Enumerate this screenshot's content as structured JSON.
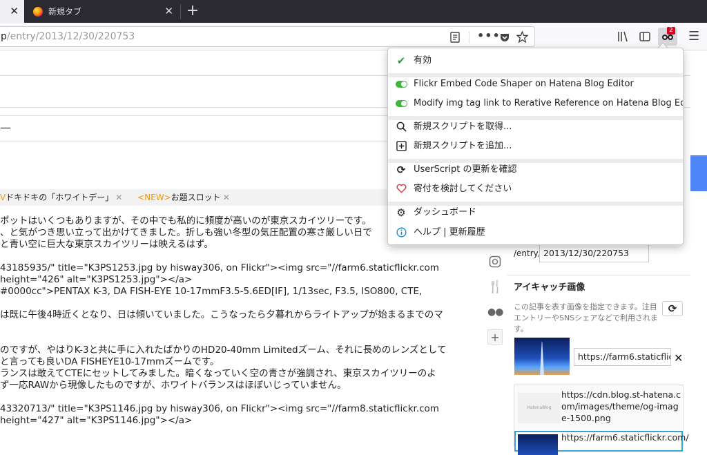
{
  "browser": {
    "tabs": [
      {
        "label": "",
        "active": true
      },
      {
        "label": "新規タブ",
        "active": false
      }
    ],
    "url_prefix": "p",
    "url_path": "/entry/2013/12/30/220753",
    "addon_badge": "2"
  },
  "menu": {
    "enabled_label": "有効",
    "scripts": [
      "Flickr Embed Code Shaper on Hatena Blog Editor",
      "Modify img tag link to Rerative Reference on Hatena Blog Editor"
    ],
    "get_new_scripts": "新規スクリプトを取得...",
    "add_new_script": "新規スクリプトを追加...",
    "check_updates": "UserScript の更新を確認",
    "donate": "寄付を検討してください",
    "dashboard": "ダッシュボード",
    "help": "ヘルプ | 更新履歴"
  },
  "editor": {
    "dash": "—",
    "tags": [
      {
        "new": "V",
        "text": "ドキドキの「ホワイトデー」"
      },
      {
        "new": "<NEW>",
        "text": "お題スロット"
      }
    ],
    "lines": [
      "ポットはいくつもありますが、その中でも私的に頻度が高いのが東京スカイツリーです。",
      "、と気がつき思い立って出かけてきました。折しも強い冬型の気圧配置の寒さ厳しい日で",
      "と青い空に巨大な東京スカイツリーは映えるはず。",
      "",
      "43185935/\" title=\"K3PS1253.jpg by hisway306, on Flickr\"><img src=\"//farm6.staticflickr.com",
      "height=\"426\" alt=\"K3PS1253.jpg\"></a>",
      " #0000cc\">PENTAX K-3, DA FISH-EYE 10-17mmF3.5-5.6ED[IF], 1/13sec, F3.5, ISO800, CTE,",
      "",
      "は既に午後4時近くとなり、日は傾いていました。こうなったら夕暮れからライトアップが始まるまでのマ",
      "",
      "",
      "のですが、やはりK-3と共に手に入れたばかりのHD20-40mm Limitedズーム、それに長めのレンズとして",
      "と言っても良いDA FISHEYE10-17mmズームです。",
      "ランスは敢えてCTEにセットしてみました。暗くなっていく空の青さが強調され、東京スカイツリーのよ",
      "ず一応RAWから現像したものですが、ホワイトバランスはほぼいじっていません。",
      "",
      "43320713/\" title=\"K3PS1146.jpg by hisway306, on Flickr\"><img src=\"//farm8.staticflickr.com",
      "height=\"427\" alt=\"K3PS1146.jpg\"></a>"
    ]
  },
  "right_panel": {
    "entry_label": "/entry/",
    "entry_value": "2013/12/30/220753",
    "eyecatch_heading": "アイキャッチ画像",
    "eyecatch_desc": "この記事を表す画像を指定できます。注目エントリーやSNSシェアなどで利用されます。",
    "image_url_value": "https://farm6.staticflickr",
    "candidate1": "https://cdn.blog.st-hatena.com/images/theme/og-image-1500.png",
    "candidate1_thumb": "HatenaBlog",
    "candidate2": "https://farm6.staticflickr.com/"
  }
}
